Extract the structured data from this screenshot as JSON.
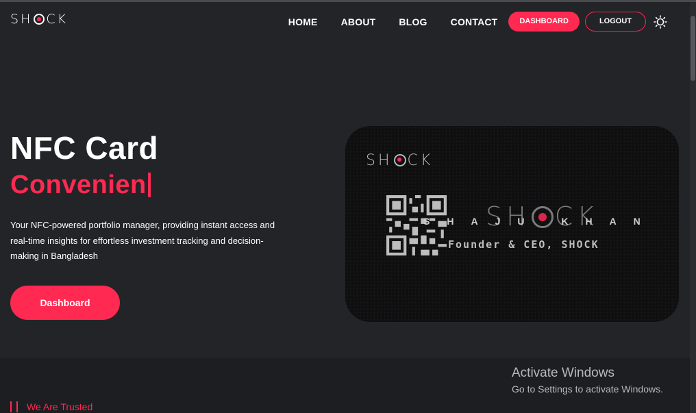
{
  "header": {
    "logo_text_left": "SH",
    "logo_text_right": "CK",
    "nav": [
      "HOME",
      "ABOUT",
      "BLOG",
      "CONTACT"
    ],
    "dashboard_button": "DASHBOARD",
    "logout_button": "LOGOUT",
    "theme_icon": "sun-icon"
  },
  "hero": {
    "title": "NFC Card",
    "typed_text": "Convenien",
    "description": "Your NFC-powered portfolio manager, providing instant access and real-time insights for effortless investment tracking and decision-making in Bangladesh",
    "cta": "Dashboard"
  },
  "card": {
    "logo_left": "SH",
    "logo_right": "CK",
    "brand_left": "SH",
    "brand_right": "CK",
    "name": "SHAJU KHAN",
    "role": "Founder & CEO, SHOCK"
  },
  "section": {
    "label": "We Are Trusted"
  },
  "watermark": {
    "title": "Activate Windows",
    "subtitle": "Go to Settings to activate Windows."
  },
  "colors": {
    "accent": "#ff2952",
    "background": "#232427",
    "card": "#0f0f10"
  }
}
